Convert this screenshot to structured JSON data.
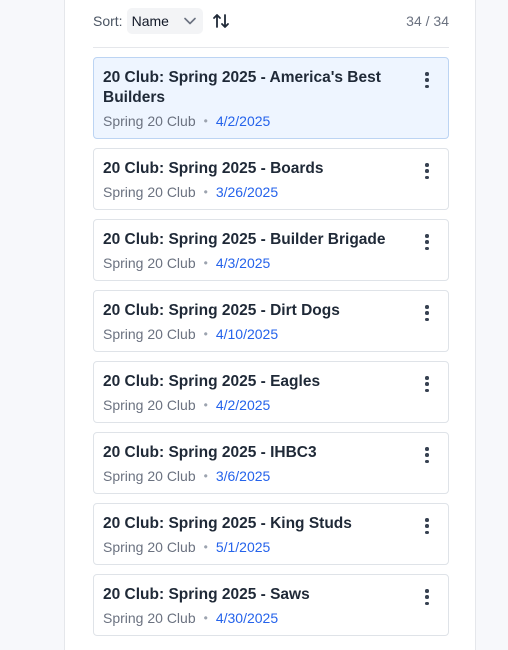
{
  "toolbar": {
    "sort_label": "Sort:",
    "sort_value": "Name",
    "count": "34 / 34"
  },
  "items": [
    {
      "title": "20 Club: Spring 2025 - America's Best Builders",
      "club": "Spring 20 Club",
      "date": "4/2/2025",
      "selected": true
    },
    {
      "title": "20 Club: Spring 2025 - Boards",
      "club": "Spring 20 Club",
      "date": "3/26/2025"
    },
    {
      "title": "20 Club: Spring 2025 - Builder Brigade",
      "club": "Spring 20 Club",
      "date": "4/3/2025"
    },
    {
      "title": "20 Club: Spring 2025 - Dirt Dogs",
      "club": "Spring 20 Club",
      "date": "4/10/2025"
    },
    {
      "title": "20 Club: Spring 2025 - Eagles",
      "club": "Spring 20 Club",
      "date": "4/2/2025"
    },
    {
      "title": "20 Club: Spring 2025 - IHBC3",
      "club": "Spring 20 Club",
      "date": "3/6/2025"
    },
    {
      "title": "20 Club: Spring 2025 - King Studs",
      "club": "Spring 20 Club",
      "date": "5/1/2025"
    },
    {
      "title": "20 Club: Spring 2025 - Saws",
      "club": "Spring 20 Club",
      "date": "4/30/2025"
    }
  ],
  "colors": {
    "accent": "#2563eb",
    "selected_bg": "#eef5ff",
    "selected_border": "#bcd4f3"
  }
}
